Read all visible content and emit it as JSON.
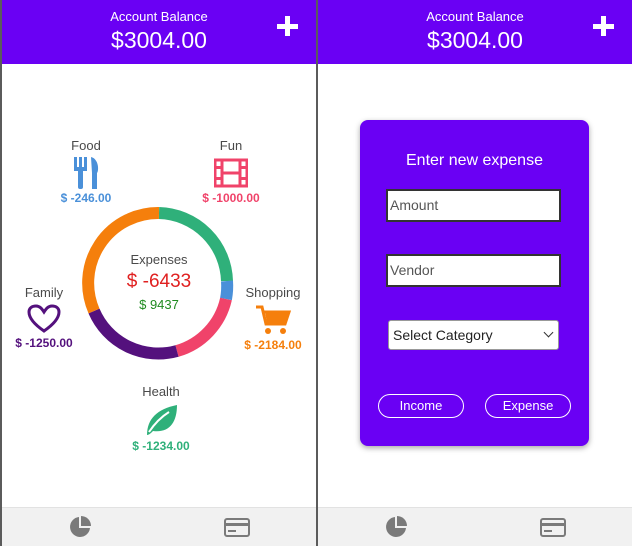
{
  "header": {
    "label": "Account Balance",
    "balance": "$3004.00",
    "add_icon": "plus-icon"
  },
  "dashboard": {
    "center_title": "Expenses",
    "total_expenses": "$ -6433",
    "total_income": "$ 9437",
    "categories": [
      {
        "name": "Food",
        "amount": "$ -246.00",
        "color": "#4a90d9",
        "icon": "fork-knife-icon"
      },
      {
        "name": "Fun",
        "amount": "$ -1000.00",
        "color": "#f0436a",
        "icon": "film-icon"
      },
      {
        "name": "Family",
        "amount": "$ -1250.00",
        "color": "#54117d",
        "icon": "heart-icon"
      },
      {
        "name": "Shopping",
        "amount": "$ -2184.00",
        "color": "#f57f0c",
        "icon": "shopping-cart-icon"
      },
      {
        "name": "Health",
        "amount": "$ -1234.00",
        "color": "#2fb07a",
        "icon": "leaf-icon"
      }
    ]
  },
  "expense_form": {
    "title": "Enter new expense",
    "amount_placeholder": "Amount",
    "vendor_placeholder": "Vendor",
    "category_selected": "Select Category",
    "income_button": "Income",
    "expense_button": "Expense"
  },
  "nav": {
    "chart_icon": "pie-chart-icon",
    "card_icon": "credit-card-icon"
  },
  "colors": {
    "accent": "#6a00f4",
    "expense_red": "#e02020",
    "income_green": "#1f8a1f"
  }
}
